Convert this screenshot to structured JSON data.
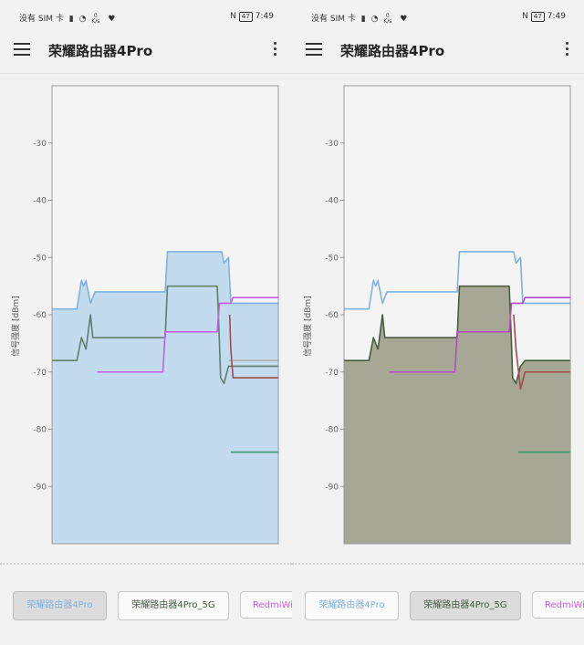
{
  "status": {
    "carrier": "没有 SIM 卡",
    "speed_value": "0",
    "speed_unit": "K/s",
    "battery": "47",
    "time": "7:49"
  },
  "app": {
    "title": "荣耀路由器4Pro"
  },
  "chart_common": {
    "ylabel": "信号强度 [dBm]",
    "yticks": [
      -30,
      -40,
      -50,
      -60,
      -70,
      -80,
      -90
    ],
    "ylim": [
      -100,
      -20
    ]
  },
  "panels": [
    {
      "tabs": [
        {
          "label": "荣耀路由器4Pro",
          "selected": true
        },
        {
          "label": "荣耀路由器4Pro_5G",
          "selected": false
        },
        {
          "label": "RedmiWiFi",
          "selected": false
        }
      ],
      "chart_data": {
        "type": "line",
        "ylabel": "信号强度 [dBm]",
        "ylim": [
          -100,
          -20
        ],
        "filled_series": 0,
        "series": [
          {
            "name": "荣耀路由器4Pro",
            "color": "#7fb2df",
            "fill": "#c3dbee",
            "points": [
              [
                0,
                -59
              ],
              [
                0.11,
                -59
              ],
              [
                0.13,
                -54
              ],
              [
                0.14,
                -55
              ],
              [
                0.15,
                -54
              ],
              [
                0.17,
                -58
              ],
              [
                0.19,
                -56
              ],
              [
                0.5,
                -56
              ],
              [
                0.51,
                -49
              ],
              [
                0.75,
                -49
              ],
              [
                0.76,
                -51
              ],
              [
                0.78,
                -50
              ],
              [
                0.79,
                -58
              ],
              [
                1,
                -58
              ]
            ]
          },
          {
            "name": "荣耀路由器4Pro_5G",
            "color": "#5f7f6a",
            "points": [
              [
                0,
                -68
              ],
              [
                0.11,
                -68
              ],
              [
                0.13,
                -64
              ],
              [
                0.15,
                -66
              ],
              [
                0.17,
                -60
              ],
              [
                0.18,
                -64
              ],
              [
                0.5,
                -64
              ],
              [
                0.51,
                -55
              ],
              [
                0.73,
                -55
              ],
              [
                0.74,
                -65
              ],
              [
                0.745,
                -71
              ],
              [
                0.76,
                -72
              ],
              [
                0.78,
                -69
              ],
              [
                0.8,
                -69
              ],
              [
                1,
                -69
              ]
            ]
          },
          {
            "name": "RedmiWiFi",
            "color": "#c85ce0",
            "points": [
              [
                0.2,
                -70
              ],
              [
                0.49,
                -70
              ],
              [
                0.5,
                -63
              ],
              [
                0.73,
                -63
              ],
              [
                0.74,
                -58
              ],
              [
                0.79,
                -58
              ],
              [
                0.8,
                -57
              ],
              [
                1,
                -57
              ]
            ]
          },
          {
            "name": "",
            "color": "#b0b0b0",
            "points": [
              [
                0.78,
                -68
              ],
              [
                1,
                -68
              ]
            ]
          },
          {
            "name": "",
            "color": "#a34a4a",
            "points": [
              [
                0.785,
                -60
              ],
              [
                0.79,
                -66
              ],
              [
                0.8,
                -71
              ],
              [
                1,
                -71
              ]
            ]
          },
          {
            "name": "",
            "color": "#3a9a72",
            "points": [
              [
                0.79,
                -84
              ],
              [
                1,
                -84
              ]
            ]
          }
        ]
      }
    },
    {
      "tabs": [
        {
          "label": "荣耀路由器4Pro",
          "selected": false
        },
        {
          "label": "荣耀路由器4Pro_5G",
          "selected": true
        },
        {
          "label": "RedmiWiFi",
          "selected": false
        }
      ],
      "chart_data": {
        "type": "line",
        "ylabel": "信号强度 [dBm]",
        "ylim": [
          -100,
          -20
        ],
        "filled_series": 1,
        "series": [
          {
            "name": "荣耀路由器4Pro",
            "color": "#7fb2df",
            "points": [
              [
                0,
                -59
              ],
              [
                0.11,
                -59
              ],
              [
                0.13,
                -54
              ],
              [
                0.14,
                -55
              ],
              [
                0.15,
                -54
              ],
              [
                0.17,
                -58
              ],
              [
                0.19,
                -56
              ],
              [
                0.5,
                -56
              ],
              [
                0.51,
                -49
              ],
              [
                0.75,
                -49
              ],
              [
                0.76,
                -51
              ],
              [
                0.78,
                -50
              ],
              [
                0.79,
                -58
              ],
              [
                1,
                -58
              ]
            ]
          },
          {
            "name": "荣耀路由器4Pro_5G",
            "color": "#4a5b3e",
            "fill": "#a6a895",
            "points": [
              [
                0,
                -68
              ],
              [
                0.11,
                -68
              ],
              [
                0.13,
                -64
              ],
              [
                0.15,
                -66
              ],
              [
                0.17,
                -60
              ],
              [
                0.18,
                -64
              ],
              [
                0.5,
                -64
              ],
              [
                0.51,
                -55
              ],
              [
                0.73,
                -55
              ],
              [
                0.74,
                -65
              ],
              [
                0.745,
                -71
              ],
              [
                0.76,
                -72
              ],
              [
                0.78,
                -69
              ],
              [
                0.8,
                -68
              ],
              [
                1,
                -68
              ]
            ]
          },
          {
            "name": "RedmiWiFi",
            "color": "#b44cc8",
            "points": [
              [
                0.2,
                -70
              ],
              [
                0.49,
                -70
              ],
              [
                0.5,
                -63
              ],
              [
                0.73,
                -63
              ],
              [
                0.74,
                -58
              ],
              [
                0.79,
                -58
              ],
              [
                0.8,
                -57
              ],
              [
                1,
                -57
              ]
            ]
          },
          {
            "name": "",
            "color": "#a34a4a",
            "points": [
              [
                0.75,
                -60
              ],
              [
                0.76,
                -66
              ],
              [
                0.78,
                -73
              ],
              [
                0.8,
                -70
              ],
              [
                1,
                -70
              ]
            ]
          },
          {
            "name": "",
            "color": "#3a9a72",
            "points": [
              [
                0.77,
                -84
              ],
              [
                1,
                -84
              ]
            ]
          }
        ]
      }
    }
  ]
}
